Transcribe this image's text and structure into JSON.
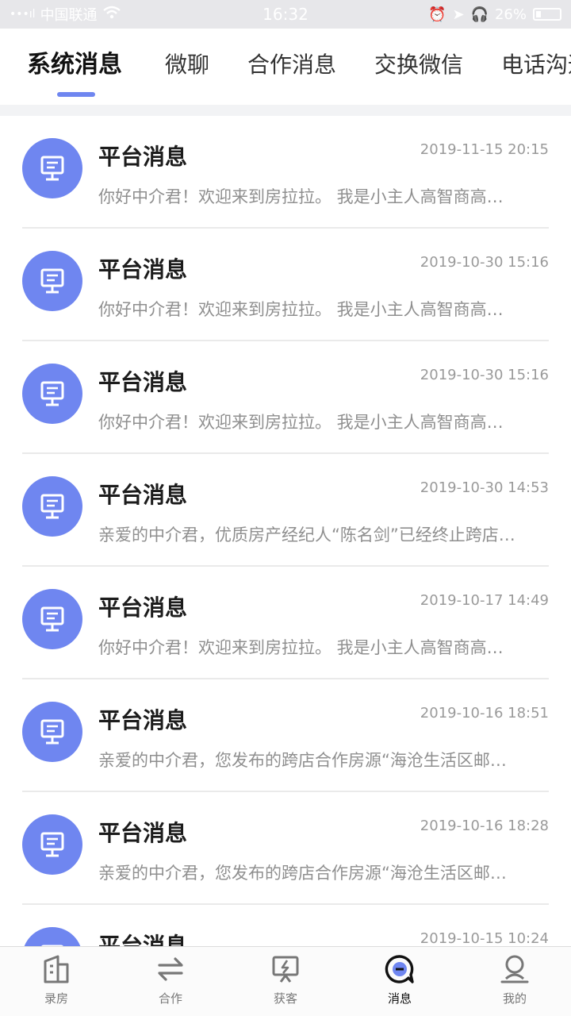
{
  "status_bar": {
    "carrier": "中国联通",
    "time": "16:32",
    "battery": "26%"
  },
  "tabs": [
    {
      "label": "系统消息",
      "active": true
    },
    {
      "label": "微聊",
      "active": false
    },
    {
      "label": "合作消息",
      "active": false
    },
    {
      "label": "交换微信",
      "active": false
    },
    {
      "label": "电话沟通",
      "active": false
    }
  ],
  "messages": [
    {
      "title": "平台消息",
      "time": "2019-11-15 20:15",
      "preview": "你好中介君！欢迎来到房拉拉。 我是小主人高智商高…"
    },
    {
      "title": "平台消息",
      "time": "2019-10-30 15:16",
      "preview": "你好中介君！欢迎来到房拉拉。 我是小主人高智商高…"
    },
    {
      "title": "平台消息",
      "time": "2019-10-30 15:16",
      "preview": "你好中介君！欢迎来到房拉拉。 我是小主人高智商高…"
    },
    {
      "title": "平台消息",
      "time": "2019-10-30 14:53",
      "preview": "亲爱的中介君，优质房产经纪人“陈名剑”已经终止跨店…"
    },
    {
      "title": "平台消息",
      "time": "2019-10-17 14:49",
      "preview": "你好中介君！欢迎来到房拉拉。 我是小主人高智商高…"
    },
    {
      "title": "平台消息",
      "time": "2019-10-16 18:51",
      "preview": "亲爱的中介君，您发布的跨店合作房源“海沧生活区邮…"
    },
    {
      "title": "平台消息",
      "time": "2019-10-16 18:28",
      "preview": "亲爱的中介君，您发布的跨店合作房源“海沧生活区邮…"
    },
    {
      "title": "平台消息",
      "time": "2019-10-15 10:24",
      "preview": ""
    }
  ],
  "bottom_nav": [
    {
      "label": "录房",
      "icon": "building-icon",
      "active": false
    },
    {
      "label": "合作",
      "icon": "swap-arrows-icon",
      "active": false
    },
    {
      "label": "获客",
      "icon": "customer-board-icon",
      "active": false
    },
    {
      "label": "消息",
      "icon": "message-bubble-icon",
      "active": true
    },
    {
      "label": "我的",
      "icon": "user-profile-icon",
      "active": false
    }
  ],
  "colors": {
    "accent": "#6f86f0",
    "title_text": "#1c1c1c",
    "secondary_text": "#8f8f8f"
  }
}
